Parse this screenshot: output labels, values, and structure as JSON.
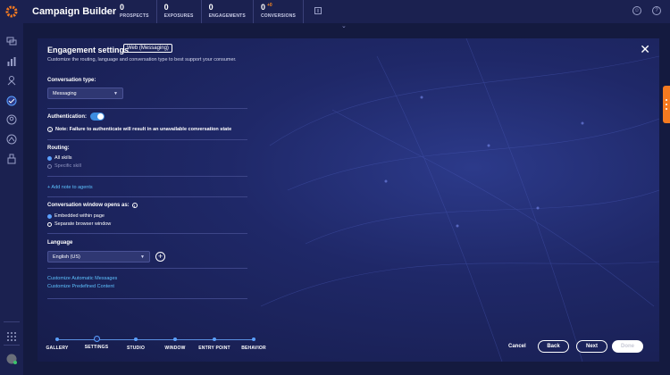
{
  "header": {
    "app_title": "Campaign Builder",
    "stats": [
      {
        "value": "0",
        "label": "PROSPECTS"
      },
      {
        "value": "0",
        "label": "EXPOSURES"
      },
      {
        "value": "0",
        "label": "ENGAGEMENTS"
      },
      {
        "value": "0",
        "delta": "+0",
        "label": "CONVERSIONS"
      }
    ]
  },
  "colors": {
    "accent": "#f47a20",
    "link": "#5ec2ff",
    "toggle_on": "#3c8de0",
    "background": "#141a3f"
  },
  "dialog": {
    "title": "Engagement settings",
    "badge": "Web (Messaging)",
    "subtitle": "Customize the routing, language and conversation type to best support your consumer.",
    "conversation_type": {
      "label": "Conversation type:",
      "value": "Messaging"
    },
    "authentication": {
      "label": "Authentication:",
      "enabled": true,
      "note": "Note: Failure to authenticate will result in an unavailable conversation state"
    },
    "routing": {
      "label": "Routing:",
      "options": [
        "All skills",
        "Specific skill"
      ],
      "selected": "All skills"
    },
    "add_note_link": "+ Add note to agents",
    "window": {
      "label": "Conversation window opens as:",
      "options": [
        "Embedded within page",
        "Separate browser window"
      ],
      "selected": "Embedded within page"
    },
    "language": {
      "label": "Language",
      "value": "English (US)"
    },
    "links": [
      "Customize Automatic Messages",
      "Customize Predefined Content"
    ]
  },
  "wizard": {
    "steps": [
      "GALLERY",
      "SETTINGS",
      "STUDIO",
      "WINDOW",
      "ENTRY POINT",
      "BEHAVIOR"
    ],
    "current": "SETTINGS"
  },
  "actions": {
    "cancel": "Cancel",
    "back": "Back",
    "next": "Next",
    "done": "Done"
  }
}
